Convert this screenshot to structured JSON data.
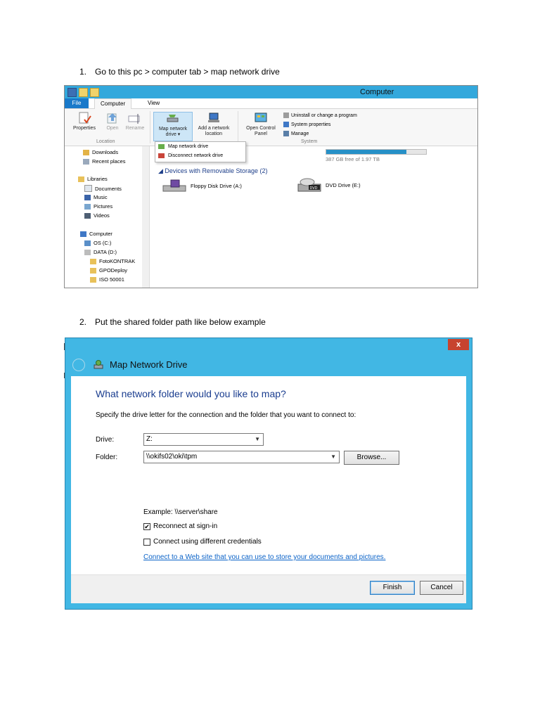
{
  "steps": [
    {
      "number": "1.",
      "text": "Go to this pc > computer tab > map network drive"
    },
    {
      "number": "2.",
      "text": "Put the shared folder path like below example"
    }
  ],
  "explorer": {
    "window_title": "Computer",
    "tabs": {
      "file": "File",
      "computer": "Computer",
      "view": "View"
    },
    "ribbon": {
      "properties": "Properties",
      "open": "Open",
      "rename": "Rename",
      "location_group": "Location",
      "map_network_drive": "Map network drive ▾",
      "add_network_location": "Add a network location",
      "open_control_panel": "Open Control Panel",
      "uninstall": "Uninstall or change a program",
      "system_properties": "System properties",
      "manage": "Manage",
      "system_group": "System"
    },
    "dropdown": {
      "map": "Map network drive",
      "disconnect": "Disconnect network drive"
    },
    "nav": {
      "downloads": "Downloads",
      "recent": "Recent places",
      "libraries": "Libraries",
      "documents": "Documents",
      "music": "Music",
      "pictures": "Pictures",
      "videos": "Videos",
      "computer": "Computer",
      "os": "OS (C:)",
      "data": "DATA (D:)",
      "foto": "FotoKONTRAK",
      "gpo": "GPODeploy",
      "iso": "ISO 50001"
    },
    "content": {
      "free_space": "387 GB free of 1.97 TB",
      "used_fraction": 0.8,
      "removable_header": "Devices with Removable Storage (2)",
      "floppy": "Floppy Disk Drive (A:)",
      "dvd": "DVD Drive (E:)",
      "dvd_badge": "DVD"
    }
  },
  "dialog": {
    "close": "x",
    "title": "Map Network Drive",
    "heading": "What network folder would you like to map?",
    "description": "Specify the drive letter for the connection and the folder that you want to connect to:",
    "drive_label": "Drive:",
    "drive_value": "Z:",
    "folder_label": "Folder:",
    "folder_value": "\\\\okifs02\\oki\\tpm",
    "browse": "Browse...",
    "example": "Example: \\\\server\\share",
    "reconnect": "Reconnect at sign-in",
    "reconnect_checked": "✔",
    "different_credentials": "Connect using different credentials",
    "link": "Connect to a Web site that you can use to store your documents and pictures.",
    "finish": "Finish",
    "cancel": "Cancel"
  }
}
